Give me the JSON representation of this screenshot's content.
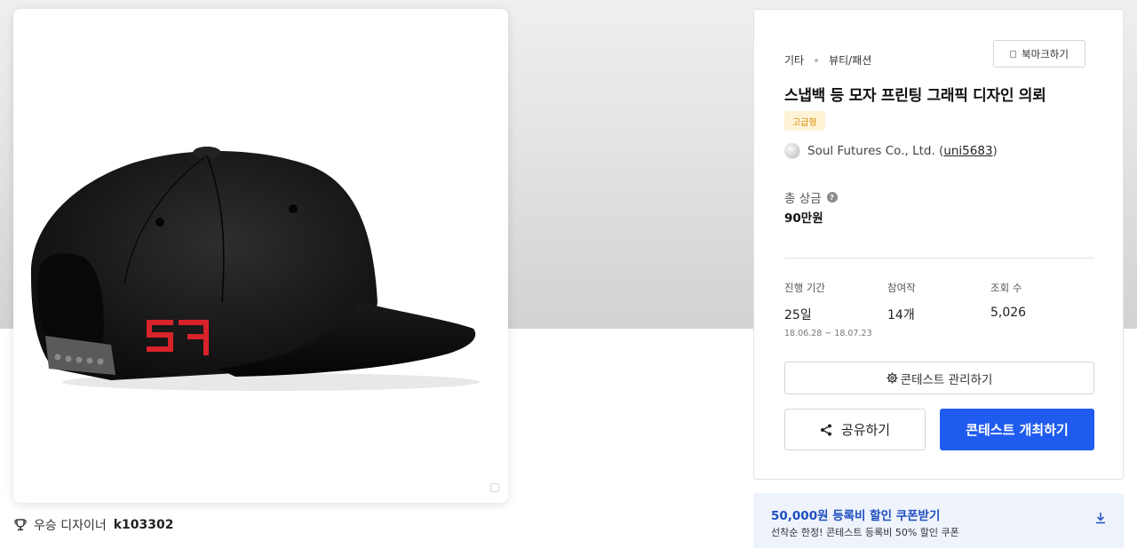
{
  "image": {
    "alt": "black snapback cap with red SF logo",
    "winner_label": "우승 디자이너",
    "winner_id": "k103302"
  },
  "panel": {
    "breadcrumb": [
      "기타",
      "뷰티/패션"
    ],
    "bookmark_label": "북마크하기",
    "title": "스냅백 등 모자 프린팅 그래픽 디자인 의뢰",
    "grade_badge": "고급형",
    "company_name": "Soul Futures Co., Ltd. (",
    "company_handle": "uni5683",
    "company_close": ")",
    "prize_label": "총 상금",
    "prize_help": "?",
    "prize_value": "90만원",
    "stats": {
      "period": {
        "label": "진행 기간",
        "value": "25일",
        "sub": "18.06.28 ~ 18.07.23"
      },
      "entries": {
        "label": "참여작",
        "value": "14개"
      },
      "views": {
        "label": "조회 수",
        "value": "5,026"
      }
    },
    "manage_label": "콘테스트 관리하기",
    "share_label": "공유하기",
    "host_label": "콘테스트 개최하기"
  },
  "coupon": {
    "title": "50,000원 등록비 할인 쿠폰받기",
    "subtitle": "선착순 한정! 콘테스트 등록비 50% 할인 쿠폰"
  },
  "colors": {
    "primary": "#1f5bef",
    "coupon_bg": "#eef3fc",
    "badge_bg": "#fff3d6",
    "badge_text": "#d48b00",
    "logo_red": "#d8232a"
  },
  "icons": [
    "trophy-icon",
    "bookmark-icon",
    "help-icon",
    "gear-icon",
    "share-icon",
    "download-icon",
    "enlarge-icon"
  ]
}
